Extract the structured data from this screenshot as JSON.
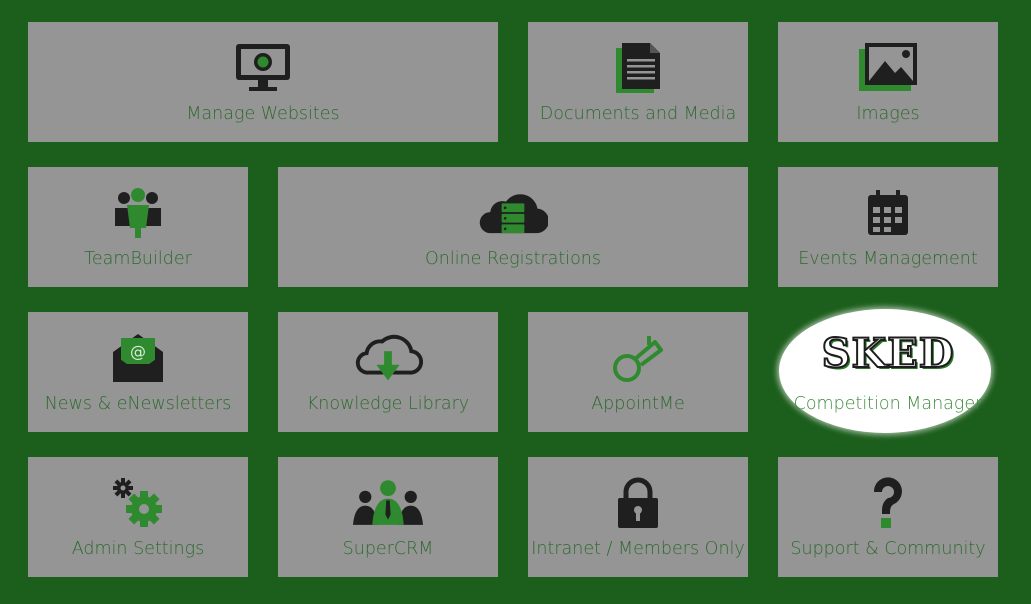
{
  "colors": {
    "background": "#1c5e1c",
    "tile": "#959595",
    "label": "#2e6a2e",
    "icon_dark": "#1f1f1f",
    "icon_green": "#2f8a2f",
    "highlight": "#ffffff"
  },
  "tiles": [
    {
      "label": "Manage Websites",
      "icon": "monitor-icon"
    },
    {
      "label": "Documents and Media",
      "icon": "document-icon"
    },
    {
      "label": "Images",
      "icon": "image-icon"
    },
    {
      "label": "TeamBuilder",
      "icon": "team-icon"
    },
    {
      "label": "Online Registrations",
      "icon": "cloud-server-icon"
    },
    {
      "label": "Events Management",
      "icon": "calendar-icon"
    },
    {
      "label": "News & eNewsletters",
      "icon": "email-envelope-icon"
    },
    {
      "label": "Knowledge Library",
      "icon": "cloud-download-icon"
    },
    {
      "label": "AppointMe",
      "icon": "whistle-icon"
    },
    {
      "label": "Competition Manager",
      "icon": "sked-logo",
      "logo_text": "SKED",
      "highlighted": true
    },
    {
      "label": "Admin Settings",
      "icon": "gears-icon"
    },
    {
      "label": "SuperCRM",
      "icon": "people-group-icon"
    },
    {
      "label": "Intranet / Members Only",
      "icon": "padlock-icon"
    },
    {
      "label": "Support & Community",
      "icon": "question-mark-icon"
    }
  ]
}
